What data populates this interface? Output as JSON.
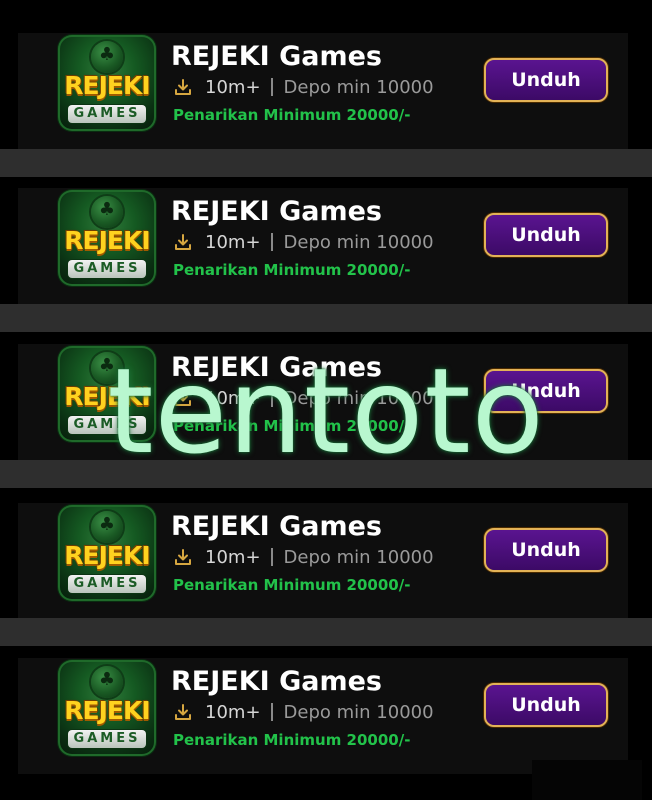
{
  "items": [
    {
      "icon_main_text": "REJEKI",
      "icon_sub_text": "GAMES",
      "title": "REJEKI Games",
      "downloads": "10m+",
      "separator": "|",
      "min_deposit": "Depo min 10000",
      "withdraw_min": "Penarikan Minimum 20000/-",
      "button_label": "Unduh",
      "download_icon": "download-icon"
    },
    {
      "icon_main_text": "REJEKI",
      "icon_sub_text": "GAMES",
      "title": "REJEKI Games",
      "downloads": "10m+",
      "separator": "|",
      "min_deposit": "Depo min 10000",
      "withdraw_min": "Penarikan Minimum 20000/-",
      "button_label": "Unduh",
      "download_icon": "download-icon"
    },
    {
      "icon_main_text": "REJEKI",
      "icon_sub_text": "GAMES",
      "title": "REJEKI Games",
      "downloads": "10m+",
      "separator": "|",
      "min_deposit": "Depo min 10000",
      "withdraw_min": "Penarikan Minimum 20000/-",
      "button_label": "Unduh",
      "download_icon": "download-icon"
    },
    {
      "icon_main_text": "REJEKI",
      "icon_sub_text": "GAMES",
      "title": "REJEKI Games",
      "downloads": "10m+",
      "separator": "|",
      "min_deposit": "Depo min 10000",
      "withdraw_min": "Penarikan Minimum 20000/-",
      "button_label": "Unduh",
      "download_icon": "download-icon"
    },
    {
      "icon_main_text": "REJEKI",
      "icon_sub_text": "GAMES",
      "title": "REJEKI Games",
      "downloads": "10m+",
      "separator": "|",
      "min_deposit": "Depo min 10000",
      "withdraw_min": "Penarikan Minimum 20000/-",
      "button_label": "Unduh",
      "download_icon": "download-icon"
    }
  ],
  "watermark": "tentoto",
  "colors": {
    "background": "#000000",
    "card": "#0e0e0e",
    "separator": "#2e2e2e",
    "title": "#ffffff",
    "downloads": "#d6d6d6",
    "deposit": "#9a9a9a",
    "withdraw": "#22c24a",
    "button_fill": "#4a0f7a",
    "button_border": "#e2b257",
    "watermark": "#b8f7cf"
  }
}
